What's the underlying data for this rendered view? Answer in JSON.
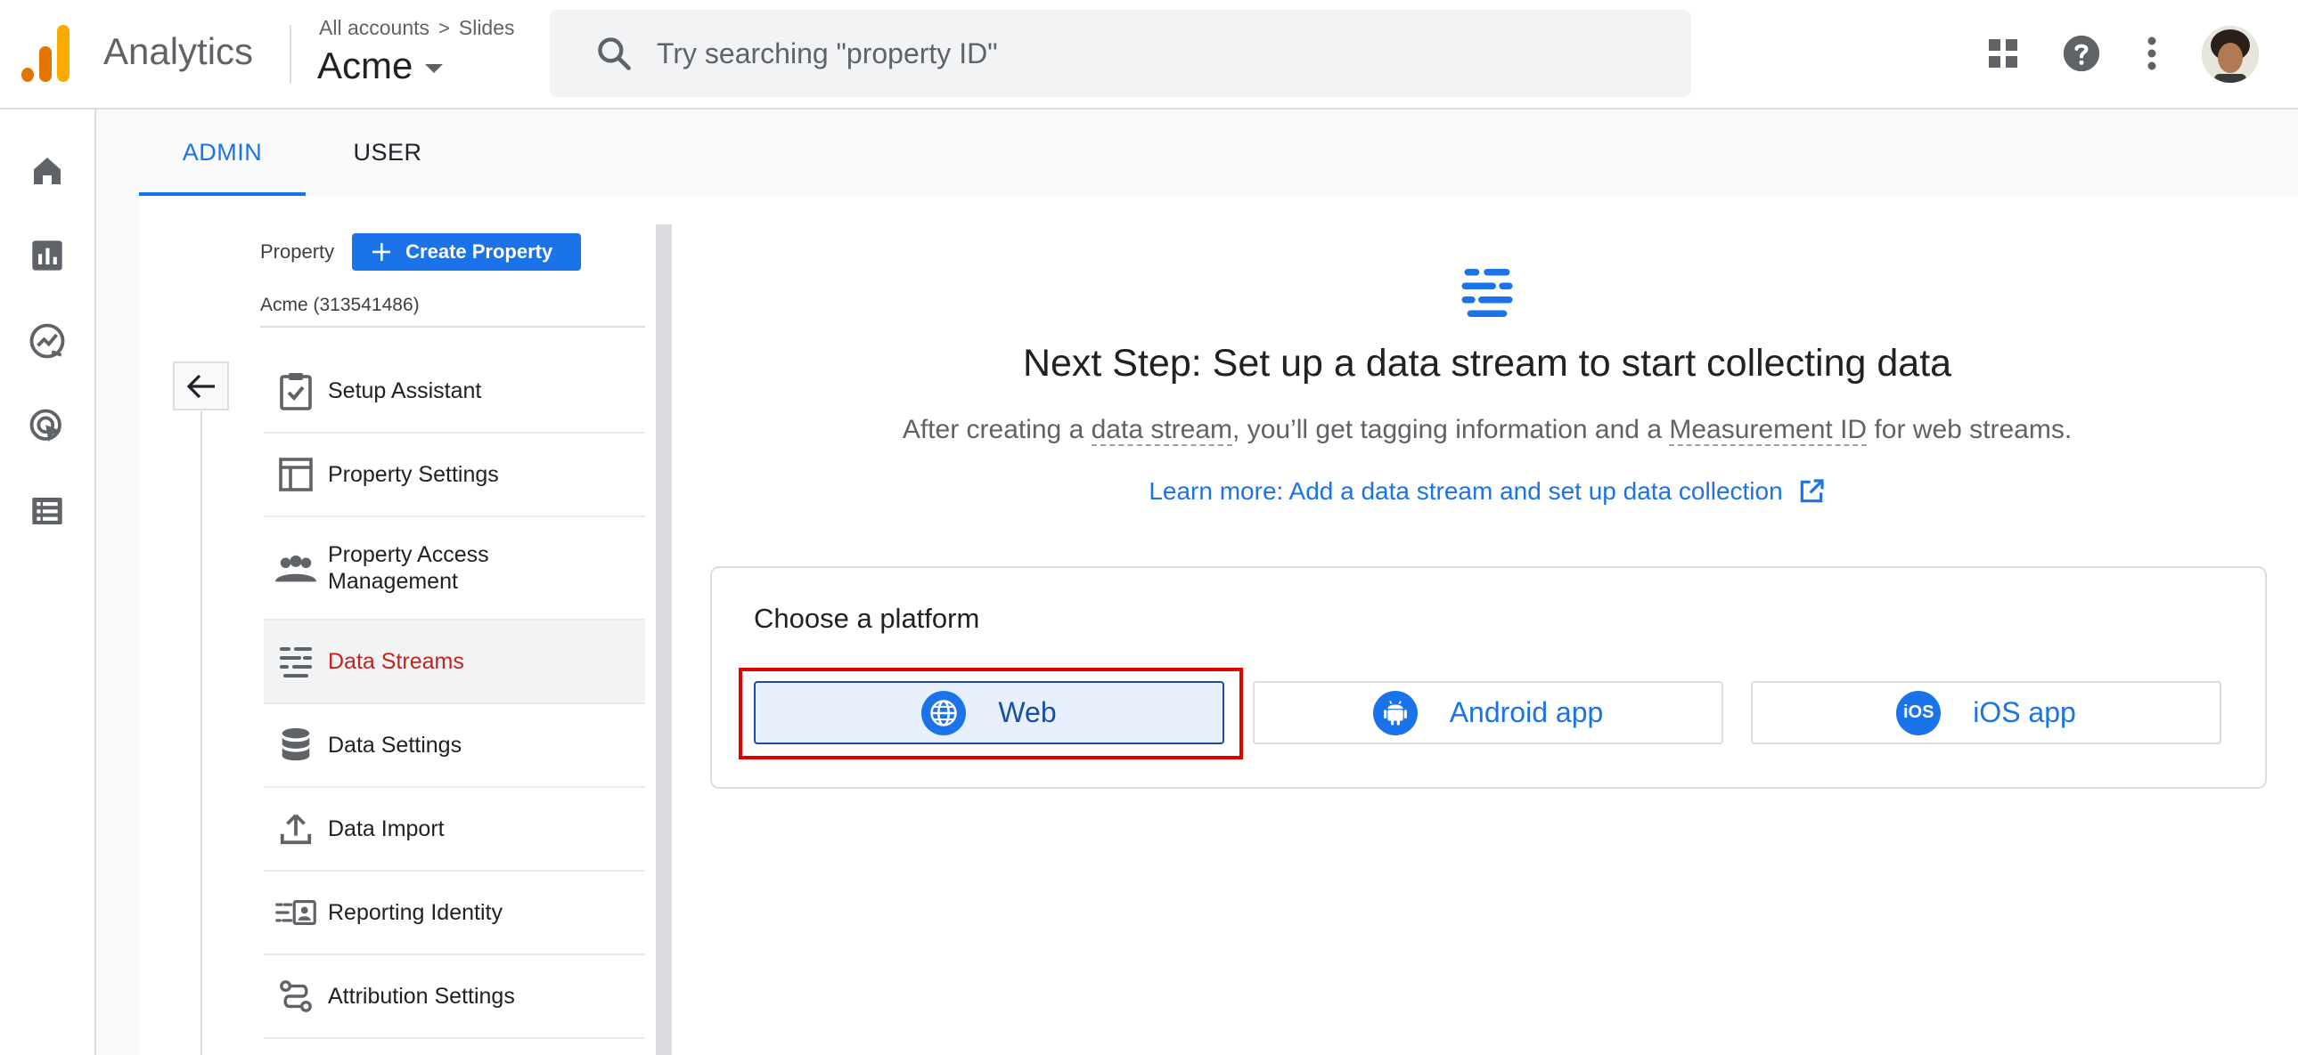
{
  "header": {
    "app_name": "Analytics",
    "breadcrumb_root": "All accounts",
    "breadcrumb_separator": ">",
    "breadcrumb_account": "Slides",
    "property_name": "Acme",
    "search_placeholder": "Try searching \"property ID\""
  },
  "header_icons": [
    "apps-grid-icon",
    "help-icon",
    "more-vert-icon",
    "user-avatar"
  ],
  "rail": {
    "items": [
      "home-icon",
      "reports-icon",
      "explore-icon",
      "advertising-icon",
      "configure-icon"
    ]
  },
  "tabs": [
    {
      "label": "ADMIN",
      "active": true
    },
    {
      "label": "USER",
      "active": false
    }
  ],
  "property_panel": {
    "label": "Property",
    "create_button": "Create Property",
    "property_id": "Acme (313541486)",
    "menu": [
      {
        "label": "Setup Assistant",
        "icon": "checklist-icon"
      },
      {
        "label": "Property Settings",
        "icon": "layout-icon"
      },
      {
        "label": "Property Access Management",
        "icon": "people-icon"
      },
      {
        "label": "Data Streams",
        "icon": "streams-icon",
        "selected": true
      },
      {
        "label": "Data Settings",
        "icon": "database-icon"
      },
      {
        "label": "Data Import",
        "icon": "upload-icon"
      },
      {
        "label": "Reporting Identity",
        "icon": "identity-icon"
      },
      {
        "label": "Attribution Settings",
        "icon": "attribution-icon"
      }
    ]
  },
  "main": {
    "headline": "Next Step: Set up a data stream to start collecting data",
    "sub_prefix": "After creating a ",
    "sub_term1": "data stream",
    "sub_mid": ", you’ll get tagging information and a ",
    "sub_term2": "Measurement ID",
    "sub_suffix": " for web streams.",
    "learn_more": "Learn more: Add a data stream and set up data collection",
    "platform_title": "Choose a platform",
    "platforms": [
      {
        "label": "Web",
        "icon": "globe-icon",
        "selected": true
      },
      {
        "label": "Android app",
        "icon": "android-icon",
        "selected": false
      },
      {
        "label": "iOS app",
        "icon": "ios-icon",
        "icon_text": "iOS",
        "selected": false
      }
    ]
  },
  "colors": {
    "accent": "#1a73e8",
    "selected_menu_text": "#c5221f",
    "highlight_box": "#e00000",
    "logo_orange": "#f9ab00",
    "logo_dark_orange": "#e37400"
  }
}
